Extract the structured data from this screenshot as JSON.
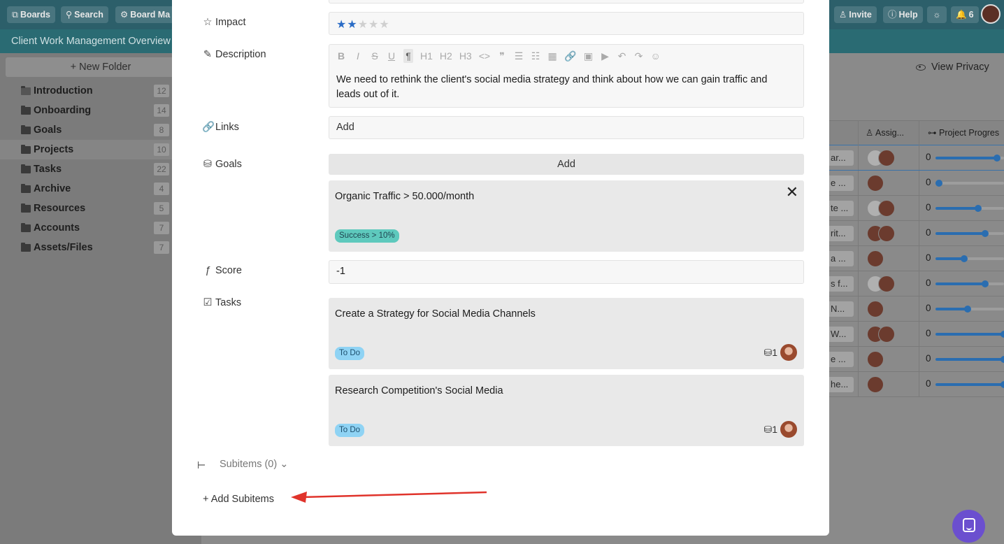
{
  "topbar": {
    "boards": "Boards",
    "search": "Search",
    "board_manager": "Board Ma",
    "invite": "Invite",
    "help": "Help",
    "notifications": "6"
  },
  "subbar": {
    "title": "Client Work Management Overview"
  },
  "sidebar": {
    "new_folder": "New Folder",
    "items": [
      {
        "label": "Introduction",
        "count": "12"
      },
      {
        "label": "Onboarding",
        "count": "14"
      },
      {
        "label": "Goals",
        "count": "8"
      },
      {
        "label": "Projects",
        "count": "10"
      },
      {
        "label": "Tasks",
        "count": "22"
      },
      {
        "label": "Archive",
        "count": "4"
      },
      {
        "label": "Resources",
        "count": "5"
      },
      {
        "label": "Accounts",
        "count": "7"
      },
      {
        "label": "Assets/Files",
        "count": "7"
      }
    ]
  },
  "view": {
    "privacy": "View Privacy"
  },
  "table": {
    "headers": {
      "assignee": "Assig...",
      "progress": "Project Progres"
    },
    "rows": [
      {
        "title": "ar...",
        "progress_text": "0",
        "progress": 0.9
      },
      {
        "title": "e ...",
        "progress_text": "0",
        "progress": 0.05
      },
      {
        "title": "te ...",
        "progress_text": "0",
        "progress": 0.62
      },
      {
        "title": "rit...",
        "progress_text": "0",
        "progress": 0.72
      },
      {
        "title": "a ...",
        "progress_text": "0",
        "progress": 0.42
      },
      {
        "title": "s f...",
        "progress_text": "0",
        "progress": 0.72
      },
      {
        "title": " N...",
        "progress_text": "0",
        "progress": 0.47
      },
      {
        "title": "W...",
        "progress_text": "0",
        "progress": 1.0
      },
      {
        "title": "e ...",
        "progress_text": "0",
        "progress": 1.0
      },
      {
        "title": "he...",
        "progress_text": "0",
        "progress": 1.0
      }
    ]
  },
  "modal": {
    "impact": {
      "label": "Impact",
      "rating": 2,
      "max": 5
    },
    "description": {
      "label": "Description",
      "text": "We need to rethink the client's social media strategy and think about how we can gain traffic and leads out of it.",
      "toolbar": [
        "B",
        "I",
        "S",
        "U",
        "¶",
        "H1",
        "H2",
        "H3",
        "<>",
        "❞",
        "☰",
        "☷",
        "▦",
        "🔗",
        "▣",
        "▶",
        "↶",
        "↷",
        "☺"
      ]
    },
    "links": {
      "label": "Links",
      "placeholder": "Add"
    },
    "goals": {
      "label": "Goals",
      "add_label": "Add",
      "items": [
        {
          "title": "Organic Traffic > 50.000/month",
          "status": "Success > 10%"
        }
      ]
    },
    "score": {
      "label": "Score",
      "value": "-1"
    },
    "tasks": {
      "label": "Tasks",
      "items": [
        {
          "title": "Create a Strategy for Social Media Channels",
          "status": "To Do",
          "goal_count": "1"
        },
        {
          "title": "Research Competition's Social Media",
          "status": "To Do",
          "goal_count": "1"
        }
      ]
    },
    "subitems": {
      "label": "Subitems (0)",
      "add_label": "Add Subitems"
    }
  },
  "colors": {
    "accent": "#2a6cc6",
    "goal_status": "#5ec9bd",
    "todo_status": "#8fd3f4",
    "annotation_arrow": "#e0332b",
    "chat": "#6b4fcf"
  }
}
